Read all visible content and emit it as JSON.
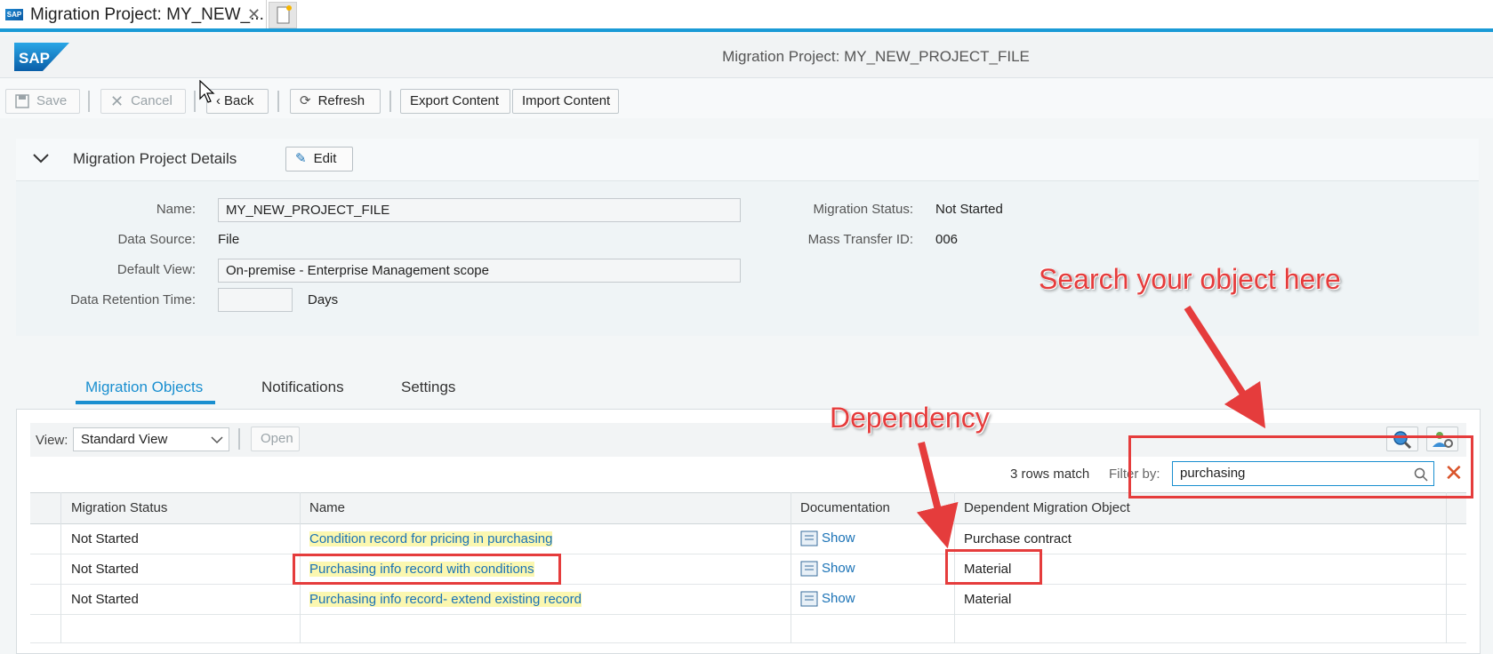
{
  "browser": {
    "tab_title": "Migration Project: MY_NEW_...",
    "favicon_text": "SAP"
  },
  "header": {
    "logo_text": "SAP",
    "title": "Migration Project: MY_NEW_PROJECT_FILE"
  },
  "toolbar": {
    "save": "Save",
    "cancel": "Cancel",
    "back": "Back",
    "refresh": "Refresh",
    "export": "Export Content",
    "import": "Import Content"
  },
  "details": {
    "title": "Migration Project Details",
    "edit": "Edit",
    "name_label": "Name:",
    "name_value": "MY_NEW_PROJECT_FILE",
    "source_label": "Data Source:",
    "source_value": "File",
    "view_label": "Default View:",
    "view_value": "On-premise - Enterprise Management scope",
    "retention_label": "Data Retention Time:",
    "retention_value": "",
    "retention_unit": "Days",
    "status_label": "Migration Status:",
    "status_value": "Not Started",
    "transfer_label": "Mass Transfer ID:",
    "transfer_value": "006"
  },
  "tabs": [
    "Migration Objects",
    "Notifications",
    "Settings"
  ],
  "table_toolbar": {
    "view_label": "View:",
    "view_value": "Standard View",
    "open": "Open",
    "rows_match": "3 rows match",
    "filter_label": "Filter by:",
    "filter_value": "purchasing"
  },
  "table": {
    "headers": [
      "Migration Status",
      "Name",
      "Documentation",
      "Dependent Migration Object"
    ],
    "rows": [
      {
        "status": "Not Started",
        "name": "Condition record for pricing in purchasing",
        "doc": "Show",
        "dependent": "Purchase contract"
      },
      {
        "status": "Not Started",
        "name": "Purchasing info record with conditions",
        "doc": "Show",
        "dependent": "Material"
      },
      {
        "status": "Not Started",
        "name": "Purchasing info record- extend existing record",
        "doc": "Show",
        "dependent": "Material"
      }
    ]
  },
  "annotations": {
    "search": "Search your object here",
    "dependency": "Dependency"
  },
  "colors": {
    "accent": "#1a8fd0",
    "annotation": "#e53c3c",
    "highlight": "#fbf7b0"
  }
}
